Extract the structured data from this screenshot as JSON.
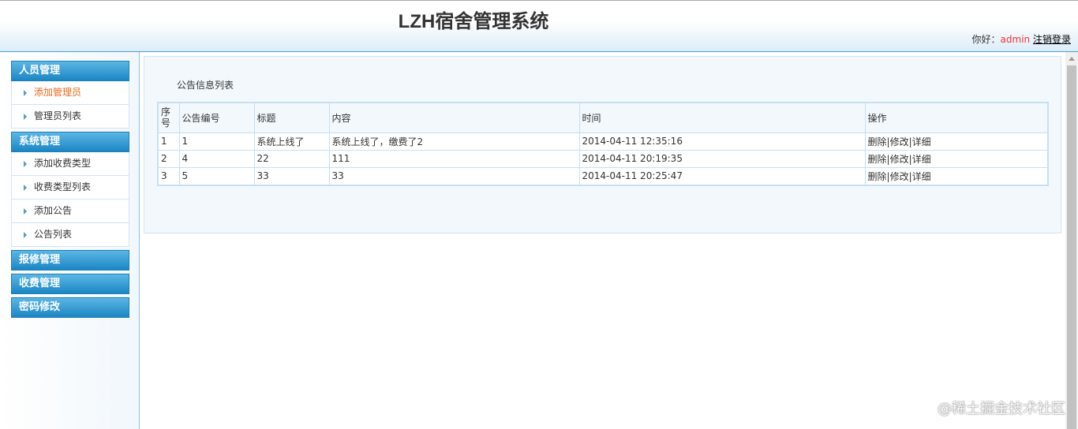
{
  "header": {
    "title": "LZH宿舍管理系统",
    "greeting": "你好：",
    "username": "admin",
    "logout": "注销登录"
  },
  "sidebar": {
    "groups": [
      {
        "label": "人员管理",
        "items": [
          "添加管理员",
          "管理员列表"
        ]
      },
      {
        "label": "系统管理",
        "items": [
          "添加收费类型",
          "收费类型列表",
          "添加公告",
          "公告列表"
        ]
      },
      {
        "label": "报修管理",
        "items": []
      },
      {
        "label": "收费管理",
        "items": []
      },
      {
        "label": "密码修改",
        "items": []
      }
    ]
  },
  "main": {
    "title": "公告信息列表",
    "columns": [
      "序号",
      "公告编号",
      "标题",
      "内容",
      "时间",
      "操作"
    ],
    "rows": [
      {
        "seq": "1",
        "id": "1",
        "title": "系统上线了",
        "content": "系统上线了，缴费了2",
        "time": "2014-04-11 12:35:16"
      },
      {
        "seq": "2",
        "id": "4",
        "title": "22",
        "content": "111",
        "time": "2014-04-11 20:19:35"
      },
      {
        "seq": "3",
        "id": "5",
        "title": "33",
        "content": "33",
        "time": "2014-04-11 20:25:47"
      }
    ],
    "actions": {
      "delete": "删除",
      "edit": "修改",
      "detail": "详细",
      "sep": "|"
    }
  },
  "watermark": "@稀土掘金技术社区"
}
